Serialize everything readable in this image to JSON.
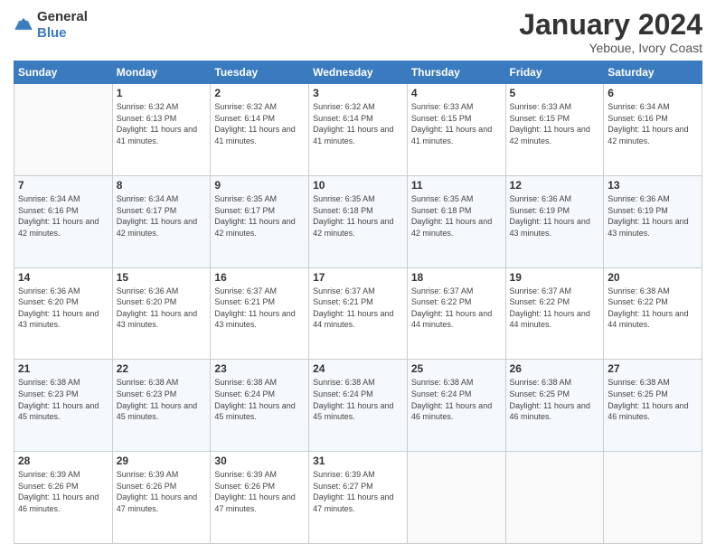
{
  "header": {
    "logo": {
      "text_general": "General",
      "text_blue": "Blue"
    },
    "title": "January 2024",
    "subtitle": "Yeboue, Ivory Coast"
  },
  "weekdays": [
    "Sunday",
    "Monday",
    "Tuesday",
    "Wednesday",
    "Thursday",
    "Friday",
    "Saturday"
  ],
  "weeks": [
    [
      {
        "day": "",
        "sunrise": "",
        "sunset": "",
        "daylight": ""
      },
      {
        "day": "1",
        "sunrise": "Sunrise: 6:32 AM",
        "sunset": "Sunset: 6:13 PM",
        "daylight": "Daylight: 11 hours and 41 minutes."
      },
      {
        "day": "2",
        "sunrise": "Sunrise: 6:32 AM",
        "sunset": "Sunset: 6:14 PM",
        "daylight": "Daylight: 11 hours and 41 minutes."
      },
      {
        "day": "3",
        "sunrise": "Sunrise: 6:32 AM",
        "sunset": "Sunset: 6:14 PM",
        "daylight": "Daylight: 11 hours and 41 minutes."
      },
      {
        "day": "4",
        "sunrise": "Sunrise: 6:33 AM",
        "sunset": "Sunset: 6:15 PM",
        "daylight": "Daylight: 11 hours and 41 minutes."
      },
      {
        "day": "5",
        "sunrise": "Sunrise: 6:33 AM",
        "sunset": "Sunset: 6:15 PM",
        "daylight": "Daylight: 11 hours and 42 minutes."
      },
      {
        "day": "6",
        "sunrise": "Sunrise: 6:34 AM",
        "sunset": "Sunset: 6:16 PM",
        "daylight": "Daylight: 11 hours and 42 minutes."
      }
    ],
    [
      {
        "day": "7",
        "sunrise": "Sunrise: 6:34 AM",
        "sunset": "Sunset: 6:16 PM",
        "daylight": "Daylight: 11 hours and 42 minutes."
      },
      {
        "day": "8",
        "sunrise": "Sunrise: 6:34 AM",
        "sunset": "Sunset: 6:17 PM",
        "daylight": "Daylight: 11 hours and 42 minutes."
      },
      {
        "day": "9",
        "sunrise": "Sunrise: 6:35 AM",
        "sunset": "Sunset: 6:17 PM",
        "daylight": "Daylight: 11 hours and 42 minutes."
      },
      {
        "day": "10",
        "sunrise": "Sunrise: 6:35 AM",
        "sunset": "Sunset: 6:18 PM",
        "daylight": "Daylight: 11 hours and 42 minutes."
      },
      {
        "day": "11",
        "sunrise": "Sunrise: 6:35 AM",
        "sunset": "Sunset: 6:18 PM",
        "daylight": "Daylight: 11 hours and 42 minutes."
      },
      {
        "day": "12",
        "sunrise": "Sunrise: 6:36 AM",
        "sunset": "Sunset: 6:19 PM",
        "daylight": "Daylight: 11 hours and 43 minutes."
      },
      {
        "day": "13",
        "sunrise": "Sunrise: 6:36 AM",
        "sunset": "Sunset: 6:19 PM",
        "daylight": "Daylight: 11 hours and 43 minutes."
      }
    ],
    [
      {
        "day": "14",
        "sunrise": "Sunrise: 6:36 AM",
        "sunset": "Sunset: 6:20 PM",
        "daylight": "Daylight: 11 hours and 43 minutes."
      },
      {
        "day": "15",
        "sunrise": "Sunrise: 6:36 AM",
        "sunset": "Sunset: 6:20 PM",
        "daylight": "Daylight: 11 hours and 43 minutes."
      },
      {
        "day": "16",
        "sunrise": "Sunrise: 6:37 AM",
        "sunset": "Sunset: 6:21 PM",
        "daylight": "Daylight: 11 hours and 43 minutes."
      },
      {
        "day": "17",
        "sunrise": "Sunrise: 6:37 AM",
        "sunset": "Sunset: 6:21 PM",
        "daylight": "Daylight: 11 hours and 44 minutes."
      },
      {
        "day": "18",
        "sunrise": "Sunrise: 6:37 AM",
        "sunset": "Sunset: 6:22 PM",
        "daylight": "Daylight: 11 hours and 44 minutes."
      },
      {
        "day": "19",
        "sunrise": "Sunrise: 6:37 AM",
        "sunset": "Sunset: 6:22 PM",
        "daylight": "Daylight: 11 hours and 44 minutes."
      },
      {
        "day": "20",
        "sunrise": "Sunrise: 6:38 AM",
        "sunset": "Sunset: 6:22 PM",
        "daylight": "Daylight: 11 hours and 44 minutes."
      }
    ],
    [
      {
        "day": "21",
        "sunrise": "Sunrise: 6:38 AM",
        "sunset": "Sunset: 6:23 PM",
        "daylight": "Daylight: 11 hours and 45 minutes."
      },
      {
        "day": "22",
        "sunrise": "Sunrise: 6:38 AM",
        "sunset": "Sunset: 6:23 PM",
        "daylight": "Daylight: 11 hours and 45 minutes."
      },
      {
        "day": "23",
        "sunrise": "Sunrise: 6:38 AM",
        "sunset": "Sunset: 6:24 PM",
        "daylight": "Daylight: 11 hours and 45 minutes."
      },
      {
        "day": "24",
        "sunrise": "Sunrise: 6:38 AM",
        "sunset": "Sunset: 6:24 PM",
        "daylight": "Daylight: 11 hours and 45 minutes."
      },
      {
        "day": "25",
        "sunrise": "Sunrise: 6:38 AM",
        "sunset": "Sunset: 6:24 PM",
        "daylight": "Daylight: 11 hours and 46 minutes."
      },
      {
        "day": "26",
        "sunrise": "Sunrise: 6:38 AM",
        "sunset": "Sunset: 6:25 PM",
        "daylight": "Daylight: 11 hours and 46 minutes."
      },
      {
        "day": "27",
        "sunrise": "Sunrise: 6:38 AM",
        "sunset": "Sunset: 6:25 PM",
        "daylight": "Daylight: 11 hours and 46 minutes."
      }
    ],
    [
      {
        "day": "28",
        "sunrise": "Sunrise: 6:39 AM",
        "sunset": "Sunset: 6:26 PM",
        "daylight": "Daylight: 11 hours and 46 minutes."
      },
      {
        "day": "29",
        "sunrise": "Sunrise: 6:39 AM",
        "sunset": "Sunset: 6:26 PM",
        "daylight": "Daylight: 11 hours and 47 minutes."
      },
      {
        "day": "30",
        "sunrise": "Sunrise: 6:39 AM",
        "sunset": "Sunset: 6:26 PM",
        "daylight": "Daylight: 11 hours and 47 minutes."
      },
      {
        "day": "31",
        "sunrise": "Sunrise: 6:39 AM",
        "sunset": "Sunset: 6:27 PM",
        "daylight": "Daylight: 11 hours and 47 minutes."
      },
      {
        "day": "",
        "sunrise": "",
        "sunset": "",
        "daylight": ""
      },
      {
        "day": "",
        "sunrise": "",
        "sunset": "",
        "daylight": ""
      },
      {
        "day": "",
        "sunrise": "",
        "sunset": "",
        "daylight": ""
      }
    ]
  ]
}
